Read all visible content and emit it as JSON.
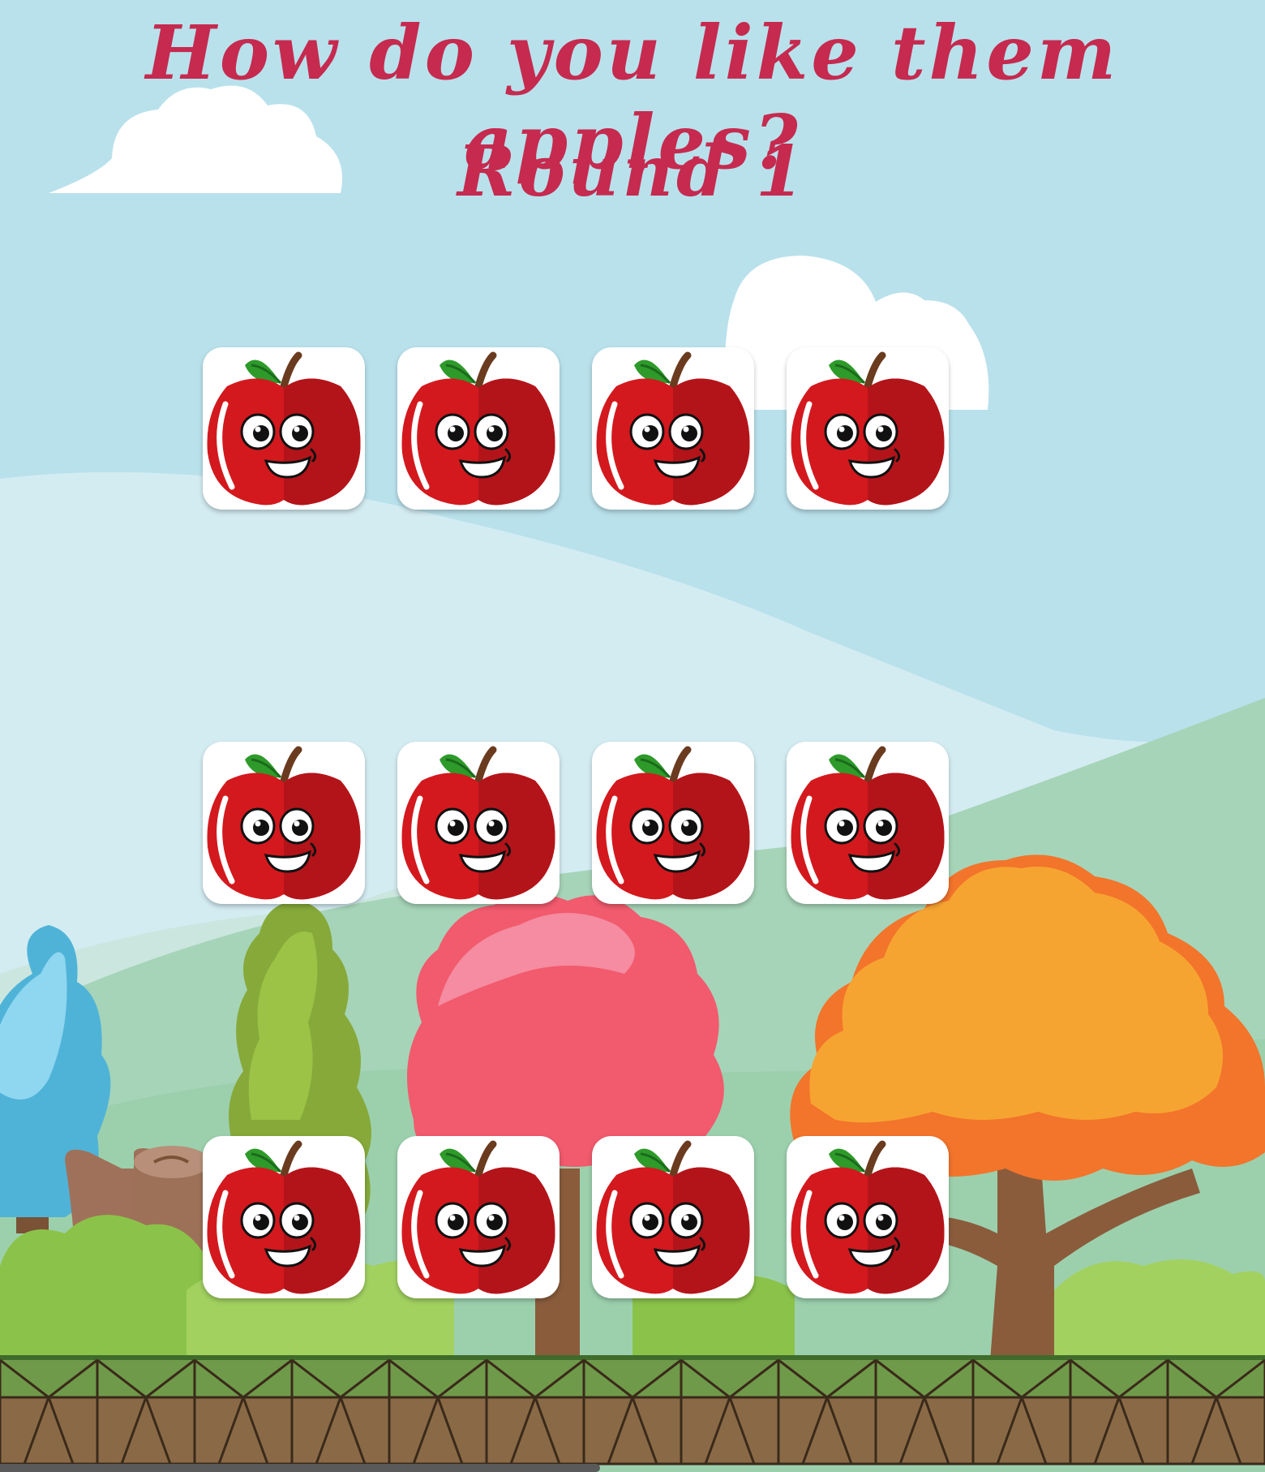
{
  "header": {
    "title": "How do you like them apples?",
    "round": "Round 1"
  },
  "board": {
    "rows": 3,
    "columns": 4,
    "cards": [
      {
        "face": "apple-face-icon",
        "state": "face-down"
      },
      {
        "face": "apple-face-icon",
        "state": "face-down"
      },
      {
        "face": "apple-face-icon",
        "state": "face-down"
      },
      {
        "face": "apple-face-icon",
        "state": "face-down"
      },
      {
        "face": "apple-face-icon",
        "state": "face-down"
      },
      {
        "face": "apple-face-icon",
        "state": "face-down"
      },
      {
        "face": "apple-face-icon",
        "state": "face-down"
      },
      {
        "face": "apple-face-icon",
        "state": "face-down"
      },
      {
        "face": "apple-face-icon",
        "state": "face-down"
      },
      {
        "face": "apple-face-icon",
        "state": "face-down"
      },
      {
        "face": "apple-face-icon",
        "state": "face-down"
      },
      {
        "face": "apple-face-icon",
        "state": "face-down"
      }
    ]
  },
  "colors": {
    "title": "#c62a4f",
    "sky": "#b9e1ec",
    "card_back": "#ffffff",
    "apple_red": "#d3191e"
  }
}
